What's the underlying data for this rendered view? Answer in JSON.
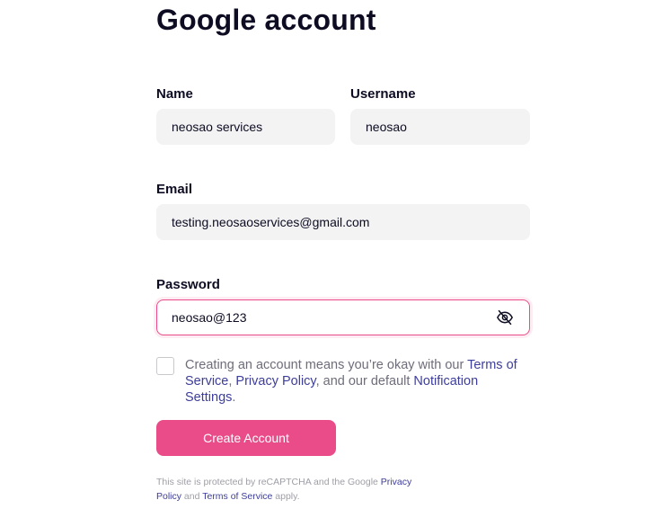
{
  "heading": "Google account",
  "form": {
    "name": {
      "label": "Name",
      "value": "neosao services"
    },
    "username": {
      "label": "Username",
      "value": "neosao"
    },
    "email": {
      "label": "Email",
      "value": "testing.neosaoservices@gmail.com"
    },
    "password": {
      "label": "Password",
      "value": "neosao@123",
      "toggle_icon": "eye-off-icon",
      "focused": true
    }
  },
  "terms": {
    "checked": false,
    "text_before": "Creating an account means you’re okay with our ",
    "terms_link": "Terms of Service",
    "sep": ", ",
    "privacy_link": "Privacy Policy",
    "text_middle": ", and our default ",
    "notification_link": "Notification Settings",
    "text_end": "."
  },
  "create_button": {
    "label": "Create Account"
  },
  "recaptcha": {
    "text_before": "This site is protected by reCAPTCHA and the Google ",
    "privacy_link": "Privacy Policy",
    "and": " and ",
    "terms_link": "Terms of Service",
    "text_end": " apply."
  },
  "colors": {
    "accent": "#ea4c89",
    "link": "#3d3d9c",
    "input_bg": "#f3f3f4",
    "text": "#0d0c22",
    "muted": "#6e6d7a"
  }
}
